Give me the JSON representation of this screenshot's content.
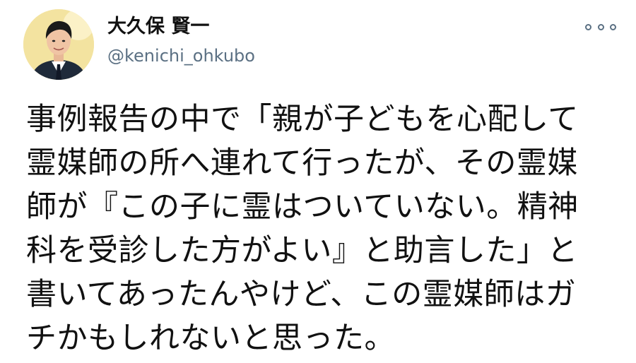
{
  "author": {
    "name": "大久保 賢一",
    "handle": "@kenichi_ohkubo",
    "avatar_icon": "profile-photo"
  },
  "more_icon": "more-options-icon",
  "tweet": {
    "lines": [
      "事例報告の中で「親が子どもを心配して",
      "霊媒師の所へ連れて行ったが、その霊媒",
      "師が『この子に霊はついていない。精神",
      "科を受診した方がよい』と助言した」と",
      "書いてあったんやけど、この霊媒師はガ",
      "チかもしれないと思った。"
    ]
  },
  "colors": {
    "text": "#111111",
    "secondary": "#5b7083",
    "avatar_bg": "#f3e3a0"
  }
}
